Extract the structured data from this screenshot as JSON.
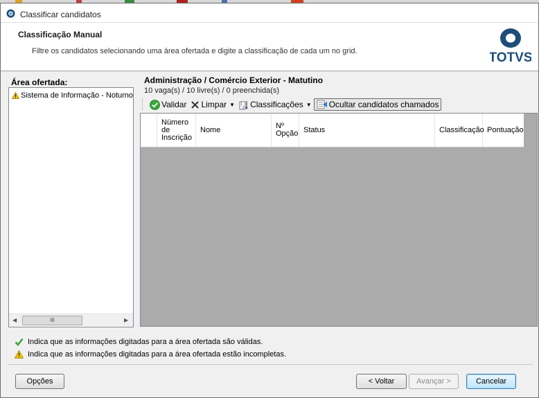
{
  "window": {
    "title": "Classificar candidatos"
  },
  "header": {
    "title": "Classificação Manual",
    "description": "Filtre os candidatos selecionando uma área ofertada e digite a classificação de cada um no grid.",
    "logo_text": "TOTVS",
    "logo_color": "#1d4e7a"
  },
  "left_panel": {
    "label": "Área ofertada:",
    "items": [
      {
        "label": "Sistema de Informação - Noturno",
        "icon": "warning-icon"
      }
    ],
    "scroll_thumb": "III"
  },
  "course": {
    "title": "Administração / Comércio Exterior - Matutino",
    "stats": "10 vaga(s) / 10 livre(s) / 0 preenchida(s)"
  },
  "toolbar": {
    "validar": "Validar",
    "limpar": "Limpar",
    "classificacoes": "Classificações",
    "ocultar": "Ocultar candidatos chamados"
  },
  "grid": {
    "columns": [
      {
        "label": "Número de Inscrição"
      },
      {
        "label": "Nome"
      },
      {
        "label": "Nº Opção"
      },
      {
        "label": "Status"
      },
      {
        "label": "Classificação"
      },
      {
        "label": "Pontuação"
      }
    ]
  },
  "legend": {
    "valid": "Indica que as informações digitadas para a área ofertada são válidas.",
    "incomplete": "Indica que as informações digitadas para a área ofertada estão incompletas."
  },
  "buttons": {
    "opcoes": "Opções",
    "voltar": "< Voltar",
    "avancar": "Avançar >",
    "cancelar": "Cancelar"
  },
  "colors": {
    "accent": "#3c7fb1",
    "valid_green": "#3aa53a",
    "warning_yellow": "#f2c500"
  }
}
